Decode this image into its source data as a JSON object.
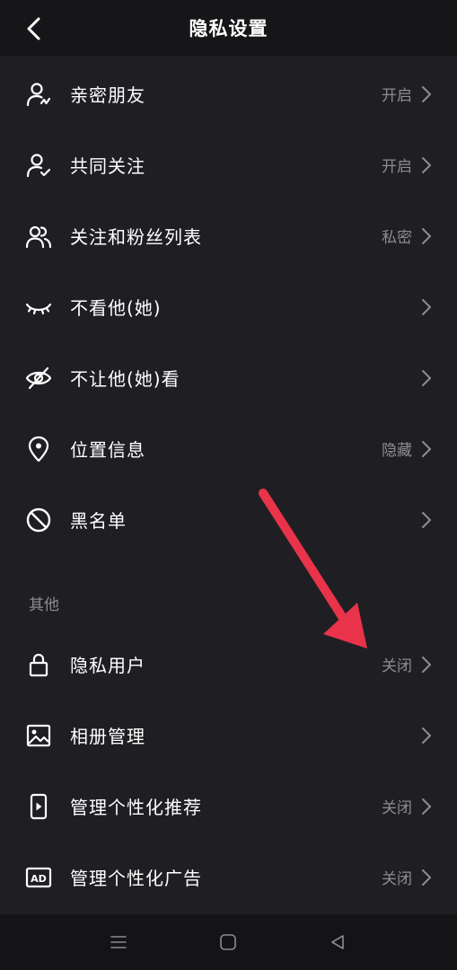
{
  "header": {
    "title": "隐私设置",
    "back_icon": "chevron-left-icon"
  },
  "items": [
    {
      "name": "close-friends",
      "icon": "user-heart-icon",
      "label": "亲密朋友",
      "value": "开启"
    },
    {
      "name": "mutual-follow",
      "icon": "user-check-icon",
      "label": "共同关注",
      "value": "开启"
    },
    {
      "name": "follow-fans-list",
      "icon": "users-icon",
      "label": "关注和粉丝列表",
      "value": "私密"
    },
    {
      "name": "not-see-them",
      "icon": "closed-eye-icon",
      "label": "不看他(她)",
      "value": ""
    },
    {
      "name": "hide-from-them",
      "icon": "eye-off-icon",
      "label": "不让他(她)看",
      "value": ""
    },
    {
      "name": "location-info",
      "icon": "location-pin-icon",
      "label": "位置信息",
      "value": "隐藏"
    },
    {
      "name": "blacklist",
      "icon": "block-icon",
      "label": "黑名单",
      "value": ""
    }
  ],
  "section_other": {
    "title": "其他"
  },
  "other_items": [
    {
      "name": "private-account",
      "icon": "lock-icon",
      "label": "隐私用户",
      "value": "关闭"
    },
    {
      "name": "album-management",
      "icon": "image-icon",
      "label": "相册管理",
      "value": ""
    },
    {
      "name": "personalized-recommendation",
      "icon": "phone-play-icon",
      "label": "管理个性化推荐",
      "value": "关闭"
    },
    {
      "name": "personalized-ads",
      "icon": "ad-icon",
      "label": "管理个性化广告",
      "value": "关闭"
    }
  ],
  "annotation": {
    "type": "arrow",
    "color": "#e8334a",
    "points_to": "private-account"
  },
  "navbar": {
    "buttons": [
      "menu-icon",
      "home-square-icon",
      "back-triangle-icon"
    ]
  },
  "colors": {
    "background": "#1f1f23",
    "header": "#161619",
    "secondary_text": "#8c8c91",
    "navbar": "#141416"
  }
}
